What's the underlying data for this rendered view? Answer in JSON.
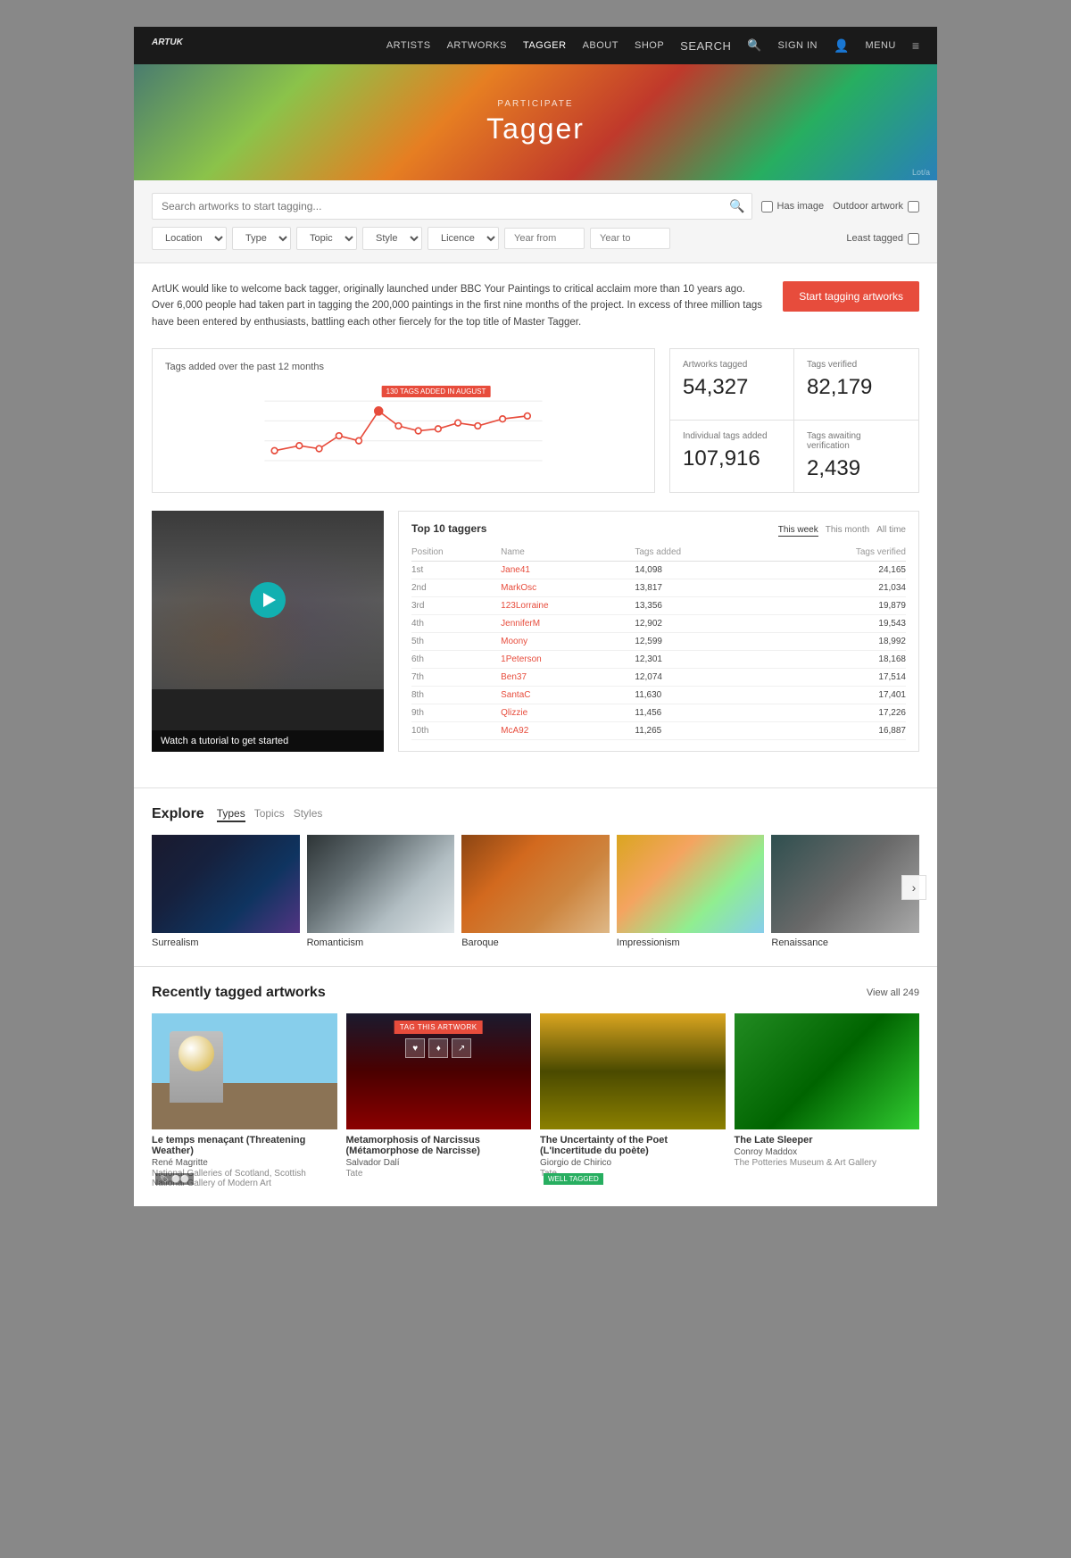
{
  "nav": {
    "logo": "ART",
    "logo_sup": "UK",
    "items": [
      "Artists",
      "Artworks",
      "Tagger",
      "About",
      "Shop"
    ],
    "search_label": "SEARCH",
    "signin_label": "SIGN IN",
    "menu_label": "MENU"
  },
  "hero": {
    "participate": "PARTICIPATE",
    "title": "Tagger",
    "credit": "Lot/a"
  },
  "search": {
    "placeholder": "Search artworks to start tagging...",
    "has_image_label": "Has image",
    "outdoor_label": "Outdoor artwork",
    "location_label": "Location",
    "type_label": "Type",
    "topic_label": "Topic",
    "style_label": "Style",
    "licence_label": "Licence",
    "year_from_placeholder": "Year from",
    "year_to_placeholder": "Year to",
    "least_tagged_label": "Least tagged"
  },
  "intro": {
    "text": "ArtUK would like to welcome back tagger, originally launched under BBC Your Paintings to critical acclaim more than 10 years ago. Over 6,000 people had taken part in tagging the 200,000 paintings in the first nine months of the project. In excess of three million tags have been entered by enthusiasts, battling each other fiercely for the top title of Master Tagger.",
    "cta": "Start tagging artworks"
  },
  "chart": {
    "title": "Tags added over the past 12 months",
    "tooltip": "130 TAGS ADDED IN AUGUST"
  },
  "stats": {
    "artworks_tagged_label": "Artworks tagged",
    "artworks_tagged_value": "54,327",
    "tags_verified_label": "Tags verified",
    "tags_verified_value": "82,179",
    "individual_tags_label": "Individual tags added",
    "individual_tags_value": "107,916",
    "awaiting_label": "Tags awaiting verification",
    "awaiting_value": "2,439"
  },
  "video": {
    "label": "Watch a tutorial to get started"
  },
  "leaderboard": {
    "title": "Top 10 taggers",
    "tabs": [
      "This week",
      "This month",
      "All time"
    ],
    "active_tab": "This week",
    "columns": [
      "Position",
      "Name",
      "Tags added",
      "Tags verified"
    ],
    "rows": [
      {
        "position": "1st",
        "name": "Jane41",
        "tags_added": "14,098",
        "tags_verified": "24,165"
      },
      {
        "position": "2nd",
        "name": "MarkOsc",
        "tags_added": "13,817",
        "tags_verified": "21,034"
      },
      {
        "position": "3rd",
        "name": "123Lorraine",
        "tags_added": "13,356",
        "tags_verified": "19,879"
      },
      {
        "position": "4th",
        "name": "JenniferM",
        "tags_added": "12,902",
        "tags_verified": "19,543"
      },
      {
        "position": "5th",
        "name": "Moony",
        "tags_added": "12,599",
        "tags_verified": "18,992"
      },
      {
        "position": "6th",
        "name": "1Peterson",
        "tags_added": "12,301",
        "tags_verified": "18,168"
      },
      {
        "position": "7th",
        "name": "Ben37",
        "tags_added": "12,074",
        "tags_verified": "17,514"
      },
      {
        "position": "8th",
        "name": "SantaC",
        "tags_added": "11,630",
        "tags_verified": "17,401"
      },
      {
        "position": "9th",
        "name": "Qlizzie",
        "tags_added": "11,456",
        "tags_verified": "17,226"
      },
      {
        "position": "10th",
        "name": "McA92",
        "tags_added": "11,265",
        "tags_verified": "16,887"
      }
    ]
  },
  "explore": {
    "title": "Explore",
    "tabs": [
      "Types",
      "Topics",
      "Styles"
    ],
    "active_tab": "Types",
    "art_types": [
      {
        "label": "Surrealism"
      },
      {
        "label": "Romanticism"
      },
      {
        "label": "Baroque"
      },
      {
        "label": "Impressionism"
      },
      {
        "label": "Renaissance"
      }
    ]
  },
  "recently_tagged": {
    "title": "Recently tagged artworks",
    "view_all": "View all 249",
    "artworks": [
      {
        "title": "Le temps menaçant (Threatening Weather)",
        "artist": "René Magritte",
        "gallery": "National Galleries of Scotland, Scottish National Gallery of Modern Art"
      },
      {
        "title": "Metamorphosis of Narcissus (Métamorphose de Narcisse)",
        "artist": "Salvador Dalí",
        "gallery": "Tate",
        "tag_this": true
      },
      {
        "title": "The Uncertainty of the Poet (L'Incertitude du poète)",
        "artist": "Giorgio de Chirico",
        "gallery": "Tate",
        "well_tagged": true
      },
      {
        "title": "The Late Sleeper",
        "artist": "Conroy Maddox",
        "gallery": "The Potteries Museum & Art Gallery"
      }
    ]
  }
}
